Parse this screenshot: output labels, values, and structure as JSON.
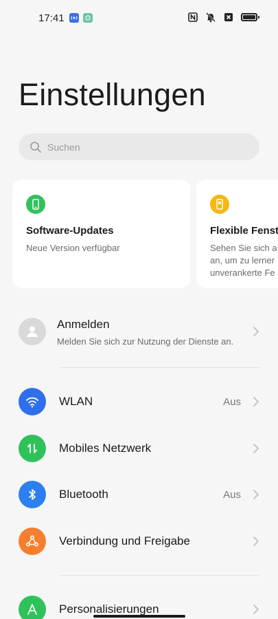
{
  "status_bar": {
    "time": "17:41"
  },
  "title": "Einstellungen",
  "search": {
    "placeholder": "Suchen"
  },
  "cards": [
    {
      "title": "Software-Updates",
      "description": "Neue Version verfügbar",
      "icon": "phone-update-icon",
      "color": "#33c15c"
    },
    {
      "title": "Flexible Fenst",
      "description": "Sehen Sie sich a\nan, um zu lerner\nunverankerte Fe",
      "icon": "flexible-window-icon",
      "color": "#f5b814"
    }
  ],
  "account": {
    "title": "Anmelden",
    "subtitle": "Melden Sie sich zur Nutzung der Dienste an."
  },
  "settings": [
    {
      "label": "WLAN",
      "value": "Aus",
      "icon": "wifi-icon",
      "color": "#2f6fec"
    },
    {
      "label": "Mobiles Netzwerk",
      "value": "",
      "icon": "mobile-data-icon",
      "color": "#2fc25b"
    },
    {
      "label": "Bluetooth",
      "value": "Aus",
      "icon": "bluetooth-icon",
      "color": "#2b7ff0"
    },
    {
      "label": "Verbindung und Freigabe",
      "value": "",
      "icon": "share-icon",
      "color": "#f57f2e"
    },
    {
      "label": "Personalisierungen",
      "value": "",
      "icon": "personalization-icon",
      "color": "#2fc25b"
    }
  ]
}
